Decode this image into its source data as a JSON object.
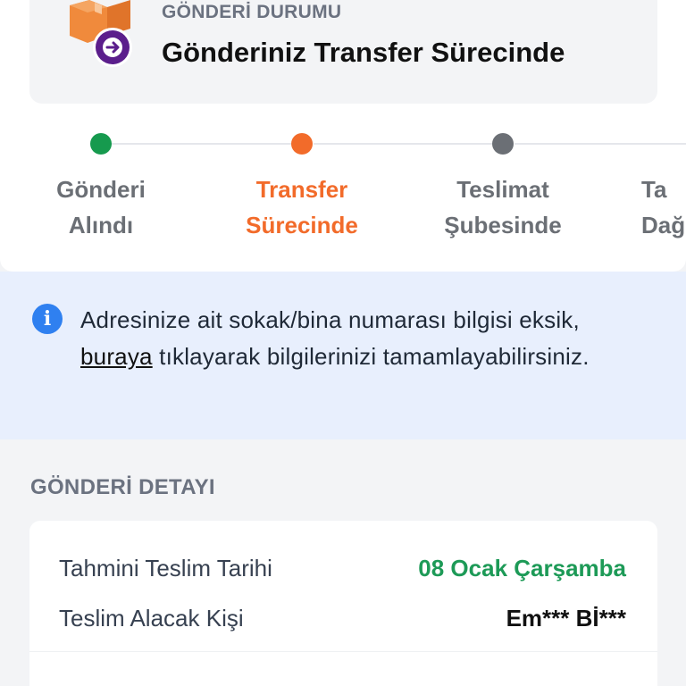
{
  "status": {
    "label": "GÖNDERİ DURUMU",
    "title": "Gönderiniz Transfer Sürecinde"
  },
  "tracker": {
    "steps": [
      {
        "line1": "Gönderi",
        "line2": "Alındı",
        "state": "done"
      },
      {
        "line1": "Transfer",
        "line2": "Sürecinde",
        "state": "current"
      },
      {
        "line1": "Teslimat",
        "line2": "Şubesinde",
        "state": "pending"
      },
      {
        "line1": "Ta",
        "line2": "Dağ",
        "state": "pending"
      }
    ]
  },
  "info": {
    "text_before": "Adresinize ait sokak/bina numarası bilgisi eksik,",
    "link": "buraya",
    "text_after": "tıklayarak bilgilerinizi tamamlayabilirsiniz."
  },
  "details": {
    "section_title": "GÖNDERİ DETAYI",
    "rows": [
      {
        "label": "Tahmini Teslim Tarihi",
        "value": "08 Ocak Çarşamba"
      },
      {
        "label": "Teslim Alacak Kişi",
        "value": "Em*** Bİ***"
      }
    ]
  },
  "colors": {
    "done": "#169a4e",
    "current": "#f26b2a",
    "pending": "#6b6f75",
    "accent_green": "#1d9a57",
    "info_blue": "#2f80f0",
    "brand_purple": "#5b1e8c"
  }
}
